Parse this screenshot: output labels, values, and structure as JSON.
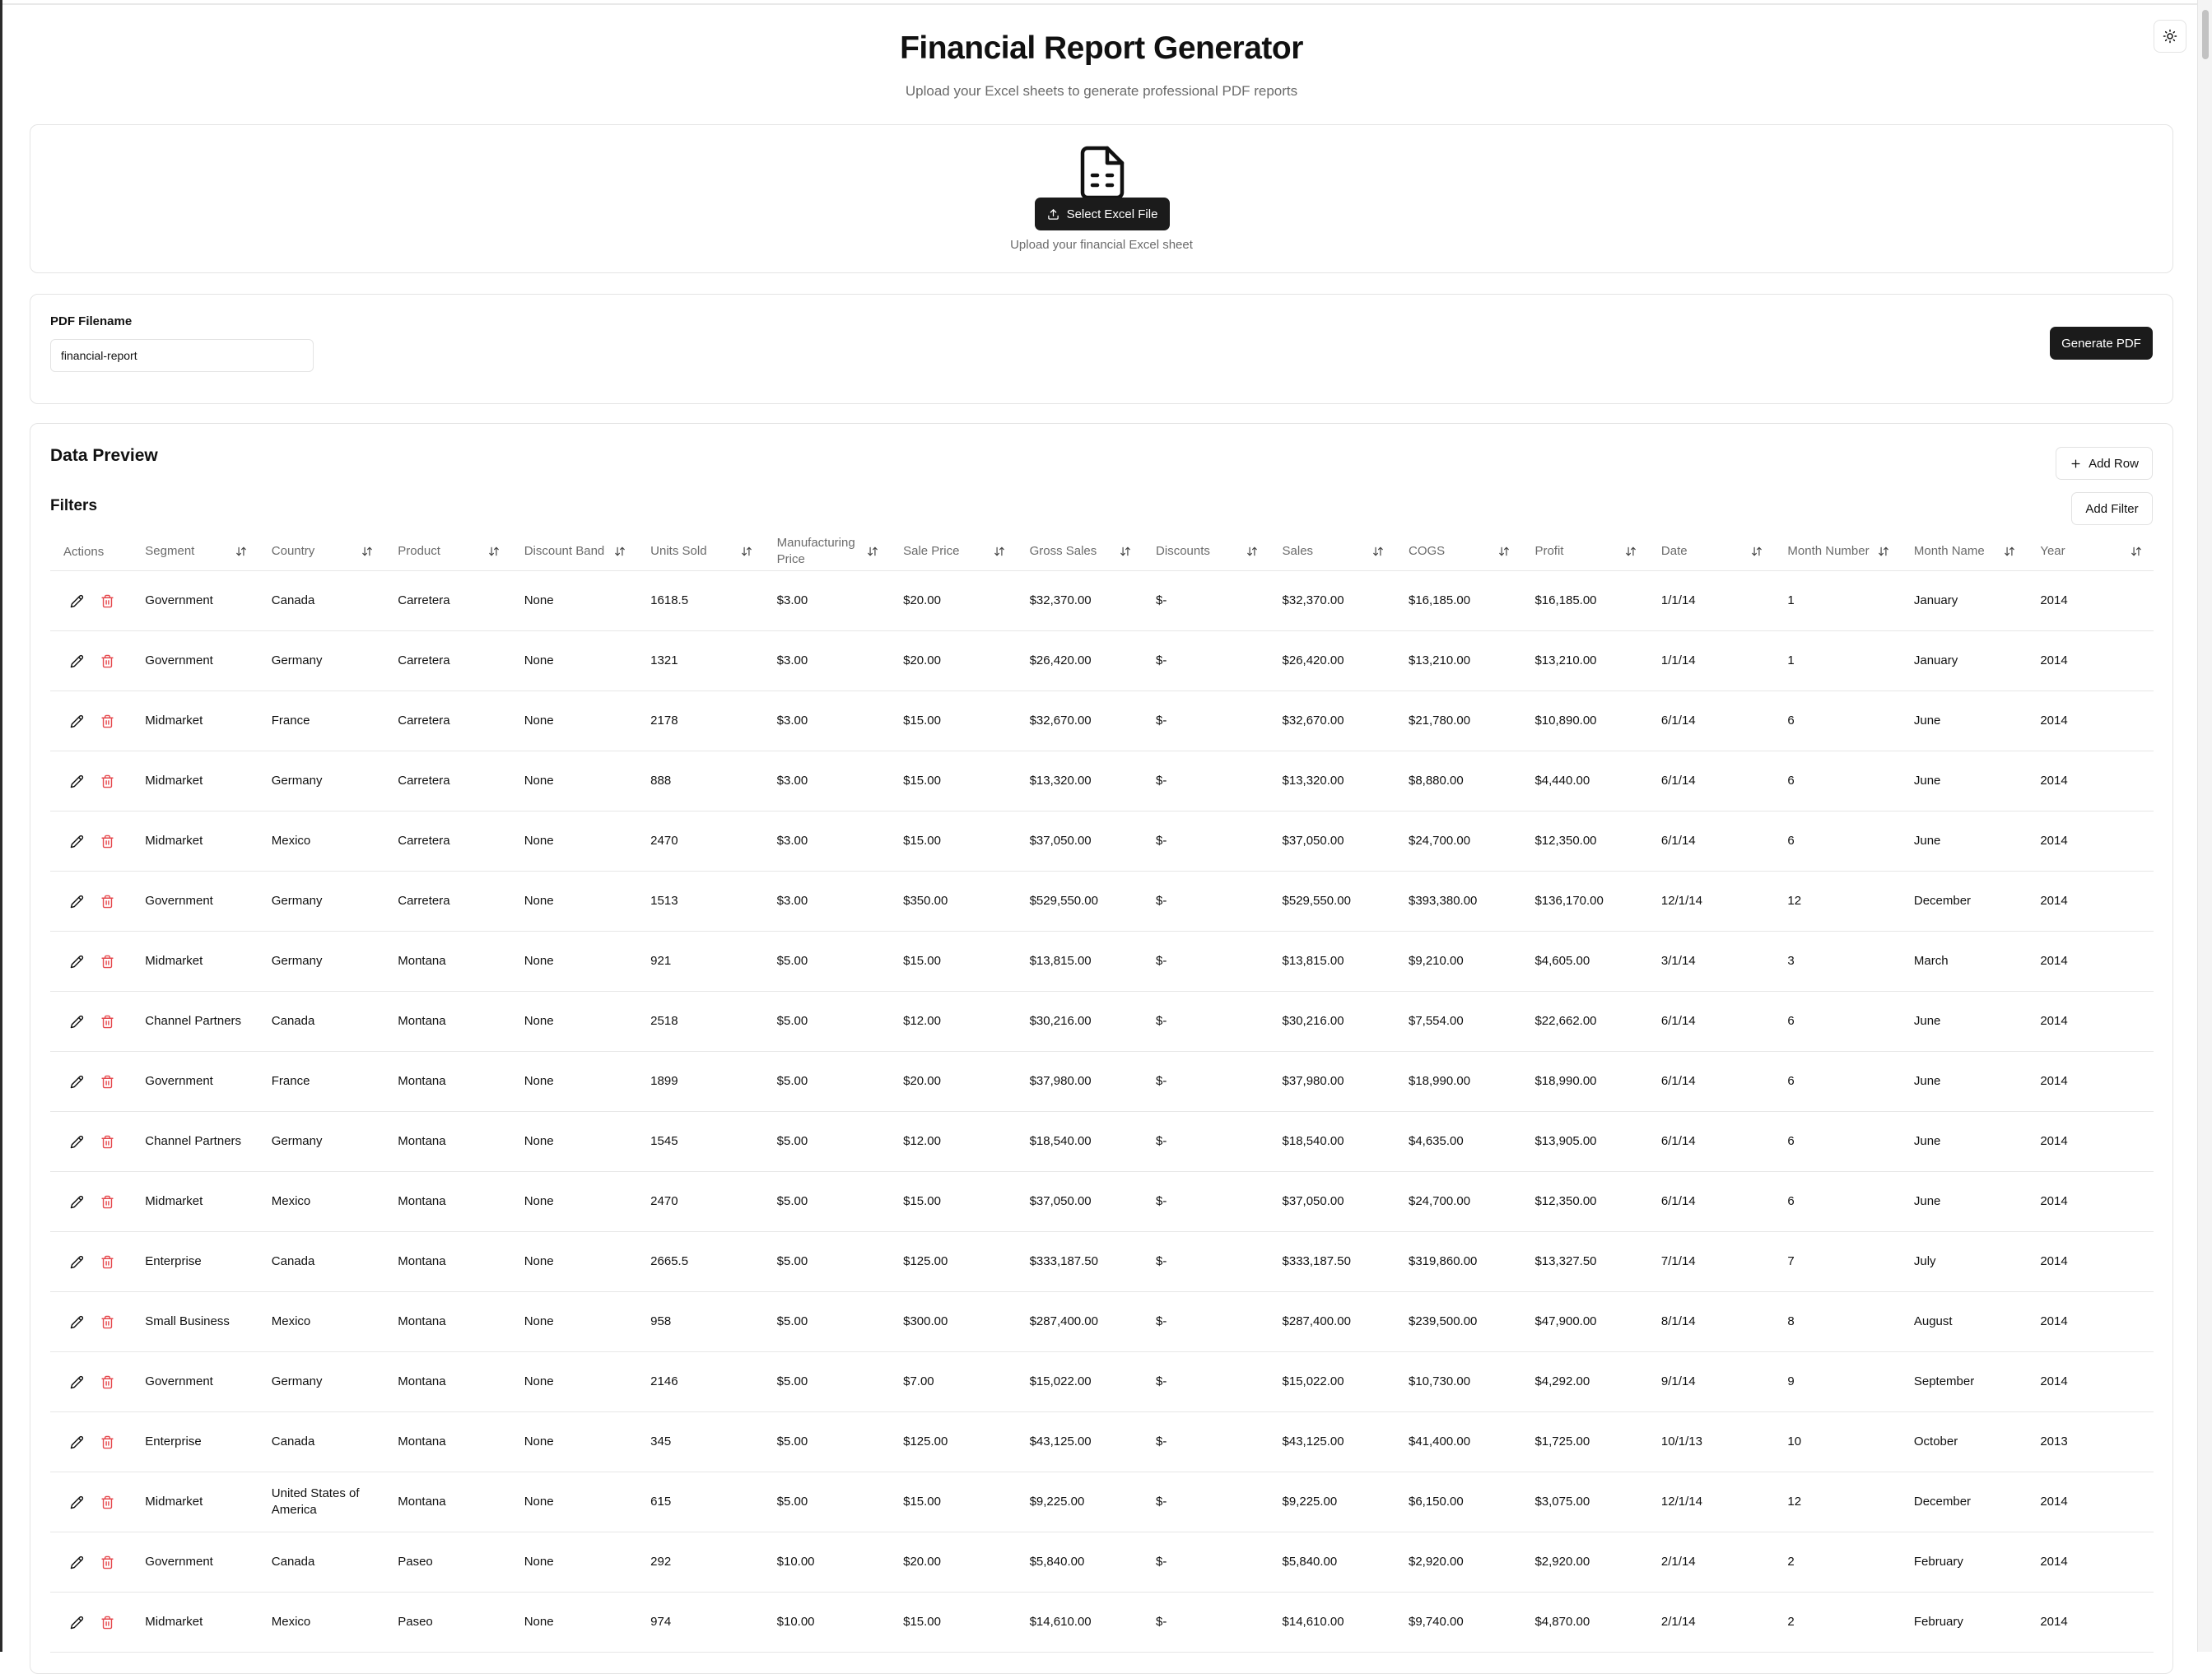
{
  "header": {
    "title": "Financial Report Generator",
    "subtitle": "Upload your Excel sheets to generate professional PDF reports"
  },
  "upload": {
    "button_label": "Select Excel File",
    "hint": "Upload your financial Excel sheet"
  },
  "pdf": {
    "label": "PDF Filename",
    "value": "financial-report",
    "generate_label": "Generate PDF"
  },
  "preview": {
    "title": "Data Preview",
    "add_row_label": "Add Row",
    "filters_title": "Filters",
    "add_filter_label": "Add Filter"
  },
  "table": {
    "actions_header": "Actions",
    "columns": [
      "Segment",
      "Country",
      "Product",
      "Discount Band",
      "Units Sold",
      "Manufacturing Price",
      "Sale Price",
      "Gross Sales",
      "Discounts",
      "Sales",
      "COGS",
      "Profit",
      "Date",
      "Month Number",
      "Month Name",
      "Year"
    ],
    "rows": [
      [
        "Government",
        "Canada",
        "Carretera",
        "None",
        "1618.5",
        "$3.00",
        "$20.00",
        "$32,370.00",
        "$-",
        "$32,370.00",
        "$16,185.00",
        "$16,185.00",
        "1/1/14",
        "1",
        "January",
        "2014"
      ],
      [
        "Government",
        "Germany",
        "Carretera",
        "None",
        "1321",
        "$3.00",
        "$20.00",
        "$26,420.00",
        "$-",
        "$26,420.00",
        "$13,210.00",
        "$13,210.00",
        "1/1/14",
        "1",
        "January",
        "2014"
      ],
      [
        "Midmarket",
        "France",
        "Carretera",
        "None",
        "2178",
        "$3.00",
        "$15.00",
        "$32,670.00",
        "$-",
        "$32,670.00",
        "$21,780.00",
        "$10,890.00",
        "6/1/14",
        "6",
        "June",
        "2014"
      ],
      [
        "Midmarket",
        "Germany",
        "Carretera",
        "None",
        "888",
        "$3.00",
        "$15.00",
        "$13,320.00",
        "$-",
        "$13,320.00",
        "$8,880.00",
        "$4,440.00",
        "6/1/14",
        "6",
        "June",
        "2014"
      ],
      [
        "Midmarket",
        "Mexico",
        "Carretera",
        "None",
        "2470",
        "$3.00",
        "$15.00",
        "$37,050.00",
        "$-",
        "$37,050.00",
        "$24,700.00",
        "$12,350.00",
        "6/1/14",
        "6",
        "June",
        "2014"
      ],
      [
        "Government",
        "Germany",
        "Carretera",
        "None",
        "1513",
        "$3.00",
        "$350.00",
        "$529,550.00",
        "$-",
        "$529,550.00",
        "$393,380.00",
        "$136,170.00",
        "12/1/14",
        "12",
        "December",
        "2014"
      ],
      [
        "Midmarket",
        "Germany",
        "Montana",
        "None",
        "921",
        "$5.00",
        "$15.00",
        "$13,815.00",
        "$-",
        "$13,815.00",
        "$9,210.00",
        "$4,605.00",
        "3/1/14",
        "3",
        "March",
        "2014"
      ],
      [
        "Channel Partners",
        "Canada",
        "Montana",
        "None",
        "2518",
        "$5.00",
        "$12.00",
        "$30,216.00",
        "$-",
        "$30,216.00",
        "$7,554.00",
        "$22,662.00",
        "6/1/14",
        "6",
        "June",
        "2014"
      ],
      [
        "Government",
        "France",
        "Montana",
        "None",
        "1899",
        "$5.00",
        "$20.00",
        "$37,980.00",
        "$-",
        "$37,980.00",
        "$18,990.00",
        "$18,990.00",
        "6/1/14",
        "6",
        "June",
        "2014"
      ],
      [
        "Channel Partners",
        "Germany",
        "Montana",
        "None",
        "1545",
        "$5.00",
        "$12.00",
        "$18,540.00",
        "$-",
        "$18,540.00",
        "$4,635.00",
        "$13,905.00",
        "6/1/14",
        "6",
        "June",
        "2014"
      ],
      [
        "Midmarket",
        "Mexico",
        "Montana",
        "None",
        "2470",
        "$5.00",
        "$15.00",
        "$37,050.00",
        "$-",
        "$37,050.00",
        "$24,700.00",
        "$12,350.00",
        "6/1/14",
        "6",
        "June",
        "2014"
      ],
      [
        "Enterprise",
        "Canada",
        "Montana",
        "None",
        "2665.5",
        "$5.00",
        "$125.00",
        "$333,187.50",
        "$-",
        "$333,187.50",
        "$319,860.00",
        "$13,327.50",
        "7/1/14",
        "7",
        "July",
        "2014"
      ],
      [
        "Small Business",
        "Mexico",
        "Montana",
        "None",
        "958",
        "$5.00",
        "$300.00",
        "$287,400.00",
        "$-",
        "$287,400.00",
        "$239,500.00",
        "$47,900.00",
        "8/1/14",
        "8",
        "August",
        "2014"
      ],
      [
        "Government",
        "Germany",
        "Montana",
        "None",
        "2146",
        "$5.00",
        "$7.00",
        "$15,022.00",
        "$-",
        "$15,022.00",
        "$10,730.00",
        "$4,292.00",
        "9/1/14",
        "9",
        "September",
        "2014"
      ],
      [
        "Enterprise",
        "Canada",
        "Montana",
        "None",
        "345",
        "$5.00",
        "$125.00",
        "$43,125.00",
        "$-",
        "$43,125.00",
        "$41,400.00",
        "$1,725.00",
        "10/1/13",
        "10",
        "October",
        "2013"
      ],
      [
        "Midmarket",
        "United States of America",
        "Montana",
        "None",
        "615",
        "$5.00",
        "$15.00",
        "$9,225.00",
        "$-",
        "$9,225.00",
        "$6,150.00",
        "$3,075.00",
        "12/1/14",
        "12",
        "December",
        "2014"
      ],
      [
        "Government",
        "Canada",
        "Paseo",
        "None",
        "292",
        "$10.00",
        "$20.00",
        "$5,840.00",
        "$-",
        "$5,840.00",
        "$2,920.00",
        "$2,920.00",
        "2/1/14",
        "2",
        "February",
        "2014"
      ],
      [
        "Midmarket",
        "Mexico",
        "Paseo",
        "None",
        "974",
        "$10.00",
        "$15.00",
        "$14,610.00",
        "$-",
        "$14,610.00",
        "$9,740.00",
        "$4,870.00",
        "2/1/14",
        "2",
        "February",
        "2014"
      ]
    ]
  },
  "icons": {
    "theme": "sun-icon",
    "file": "file-spreadsheet-icon",
    "upload": "upload-icon",
    "add": "plus-icon",
    "sort": "arrow-up-down-icon",
    "edit": "pencil-icon",
    "delete": "trash-icon"
  },
  "colors": {
    "primary": "#1b1b1b",
    "delete": "#e5484d",
    "muted": "#6b6b6b",
    "border": "#e4e4e4"
  }
}
